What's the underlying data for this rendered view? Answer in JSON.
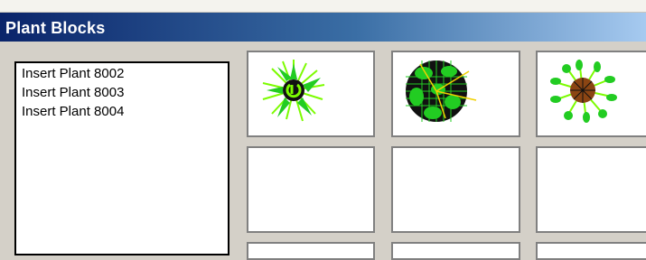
{
  "window": {
    "title": "Plant Blocks"
  },
  "blocks_list": {
    "items": [
      {
        "label": "Insert Plant 8002"
      },
      {
        "label": "Insert Plant 8003"
      },
      {
        "label": "Insert Plant 8004"
      }
    ]
  },
  "preview_grid": {
    "tiles": [
      {
        "icon": "plant-8002-symbol-icon"
      },
      {
        "icon": "plant-8003-symbol-icon"
      },
      {
        "icon": "plant-8004-symbol-icon"
      },
      {
        "icon": "empty"
      },
      {
        "icon": "empty"
      },
      {
        "icon": "empty"
      }
    ]
  },
  "colors": {
    "title_start": "#0a246a",
    "title_end": "#a6caf0",
    "dialog_bg": "#d4d0c8",
    "plant_green": "#22cc22",
    "trunk_brown": "#8b4513"
  }
}
